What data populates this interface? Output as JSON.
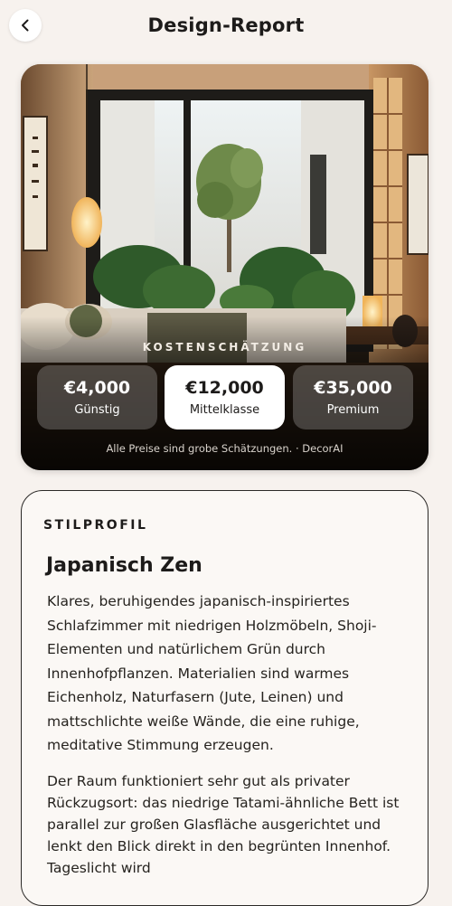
{
  "header": {
    "title": "Design-Report",
    "back_icon": "chevron-left-icon"
  },
  "hero": {
    "estimate_label": "KOSTENSCHÄTZUNG",
    "tiers": [
      {
        "price": "€4,000",
        "name": "Günstig",
        "selected": false
      },
      {
        "price": "€12,000",
        "name": "Mittelklasse",
        "selected": true
      },
      {
        "price": "€35,000",
        "name": "Premium",
        "selected": false
      }
    ],
    "disclaimer": "Alle Preise sind grobe Schätzungen. · DecorAI"
  },
  "profile": {
    "label": "STILPROFIL",
    "name": "Japanisch Zen",
    "paragraph1": "Klares, beruhigendes japanisch-inspiriertes Schlafzimmer mit niedrigen Holzmöbeln, Shoji-Elementen und natürlichem Grün durch Innenhofpflanzen. Materialien sind warmes Eichenholz, Naturfasern (Jute, Leinen) und mattschlichte weiße Wände, die eine ruhige, meditative Stimmung erzeugen.",
    "paragraph2": "Der Raum funktioniert sehr gut als privater Rückzugsort: das niedrige Tatami-ähnliche Bett ist parallel zur großen Glasfläche ausgerichtet und lenkt den Blick direkt in den begrünten Innenhof. Tageslicht wird"
  },
  "colors": {
    "background": "#f7f2ee",
    "card_border": "#2b2927",
    "selected_tier": "#ffffff"
  }
}
